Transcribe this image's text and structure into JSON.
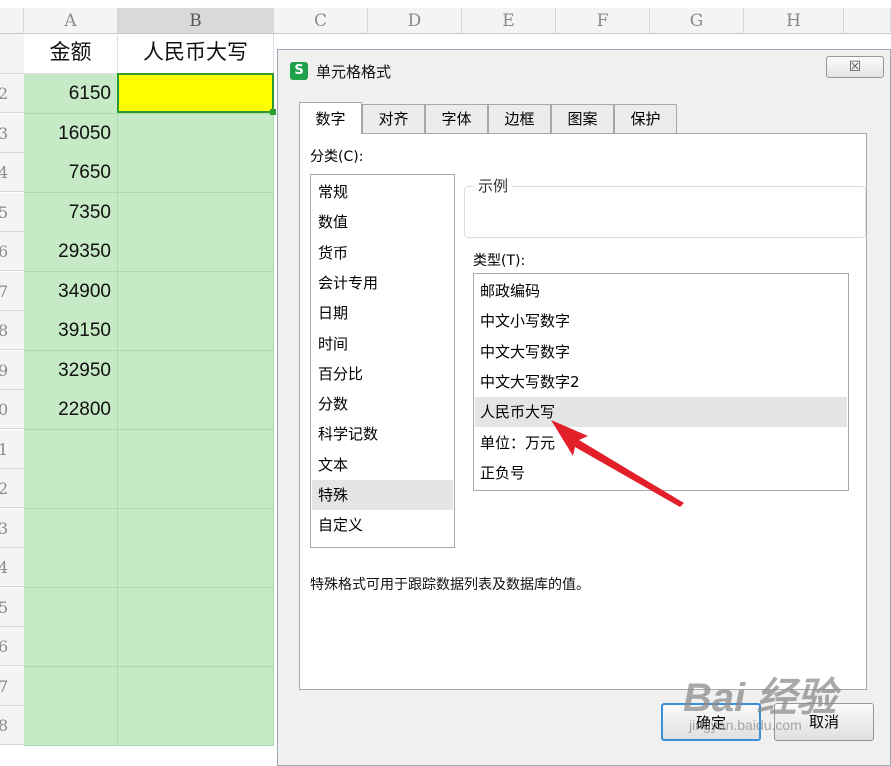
{
  "sheet": {
    "columns": [
      "A",
      "B",
      "C",
      "D",
      "E",
      "F",
      "G",
      "H"
    ],
    "row_numbers": [
      "2",
      "3",
      "4",
      "5",
      "6",
      "7",
      "8",
      "9",
      "0",
      "1",
      "2",
      "3",
      "4",
      "5",
      "6",
      "7",
      "8"
    ],
    "header_a": "金额",
    "header_b": "人民币大写",
    "amounts": [
      "6150",
      "16050",
      "7650",
      "7350",
      "29350",
      "34900",
      "39150",
      "32950",
      "22800"
    ],
    "colors": {
      "fill": "#c6e9c6",
      "active_cell": "#ffff00",
      "selection_border": "#2e9b2e"
    }
  },
  "dialog": {
    "title": "单元格格式",
    "app_icon": "S",
    "close_label": "☒",
    "tabs": [
      "数字",
      "对齐",
      "字体",
      "边框",
      "图案",
      "保护"
    ],
    "active_tab": "数字",
    "category_label": "分类(C):",
    "categories": [
      "常规",
      "数值",
      "货币",
      "会计专用",
      "日期",
      "时间",
      "百分比",
      "分数",
      "科学记数",
      "文本",
      "特殊",
      "自定义"
    ],
    "selected_category": "特殊",
    "sample_label": "示例",
    "type_label": "类型(T):",
    "types": [
      "邮政编码",
      "中文小写数字",
      "中文大写数字",
      "中文大写数字2",
      "人民币大写",
      "单位：万元",
      "正负号"
    ],
    "selected_type": "人民币大写",
    "description": "特殊格式可用于跟踪数据列表及数据库的值。",
    "ok_label": "确定",
    "cancel_label": "取消"
  },
  "watermark": {
    "main": "Bai 经验",
    "sub": "jingyan.baidu.com"
  },
  "annotation": {
    "arrow_color": "#e3202a"
  }
}
